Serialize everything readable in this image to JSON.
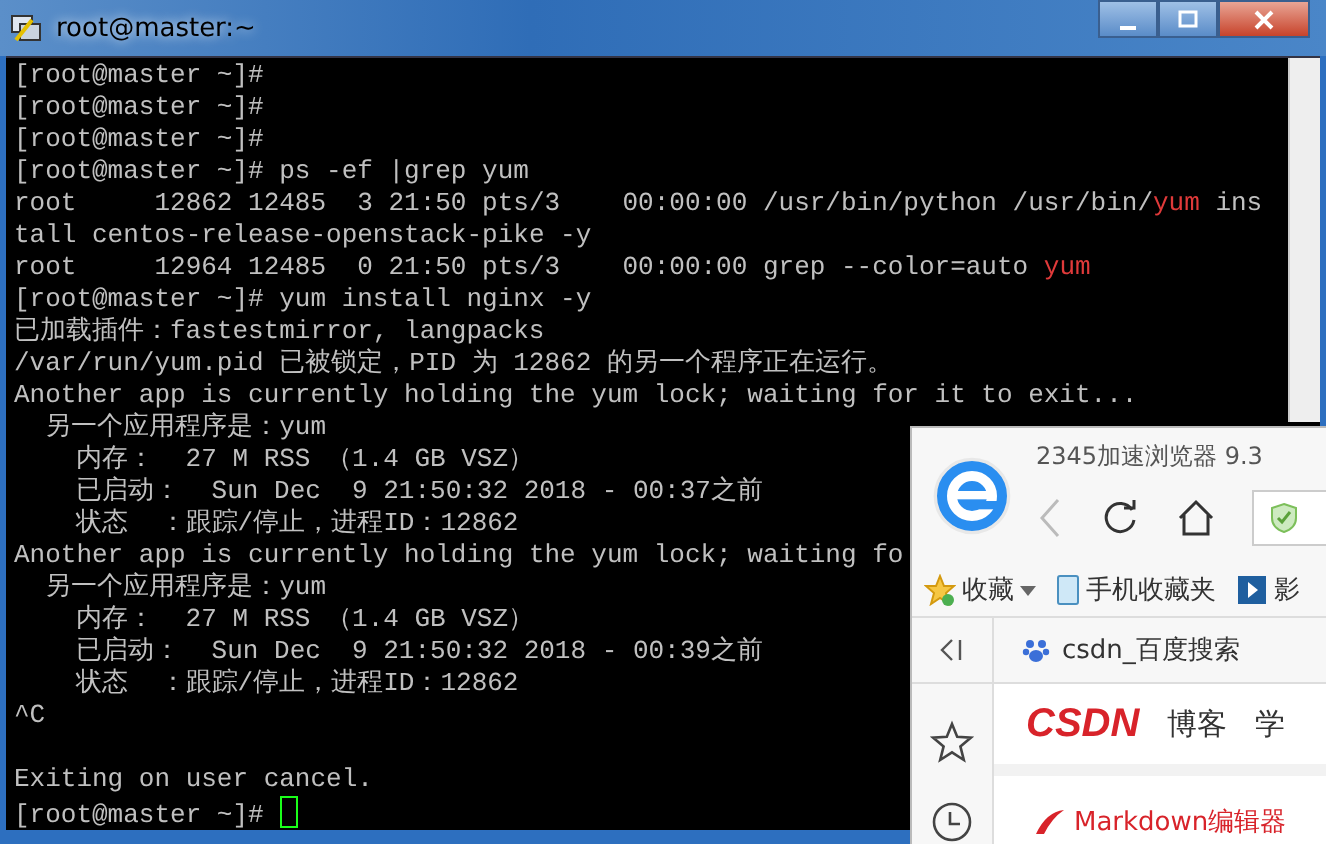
{
  "window": {
    "title": "root@master:~"
  },
  "terminal": {
    "lines": [
      {
        "segments": [
          {
            "text": "[root@master ~]#",
            "highlight": false
          }
        ]
      },
      {
        "segments": [
          {
            "text": "[root@master ~]#",
            "highlight": false
          }
        ]
      },
      {
        "segments": [
          {
            "text": "[root@master ~]#",
            "highlight": false
          }
        ]
      },
      {
        "segments": [
          {
            "text": "[root@master ~]# ps -ef |grep yum",
            "highlight": false
          }
        ]
      },
      {
        "segments": [
          {
            "text": "root     12862 12485  3 21:50 pts/3    00:00:00 /usr/bin/python /usr/bin/",
            "highlight": false
          },
          {
            "text": "yum",
            "highlight": true
          },
          {
            "text": " ins",
            "highlight": false
          }
        ]
      },
      {
        "segments": [
          {
            "text": "tall centos-release-openstack-pike -y",
            "highlight": false
          }
        ]
      },
      {
        "segments": [
          {
            "text": "root     12964 12485  0 21:50 pts/3    00:00:00 grep --color=auto ",
            "highlight": false
          },
          {
            "text": "yum",
            "highlight": true
          }
        ]
      },
      {
        "segments": [
          {
            "text": "[root@master ~]# yum install nginx -y",
            "highlight": false
          }
        ]
      },
      {
        "segments": [
          {
            "text": "已加载插件：fastestmirror, langpacks",
            "highlight": false
          }
        ]
      },
      {
        "segments": [
          {
            "text": "/var/run/yum.pid 已被锁定，PID 为 12862 的另一个程序正在运行。",
            "highlight": false
          }
        ]
      },
      {
        "segments": [
          {
            "text": "Another app is currently holding the yum lock; waiting for it to exit...",
            "highlight": false
          }
        ]
      },
      {
        "segments": [
          {
            "text": "  另一个应用程序是：yum",
            "highlight": false
          }
        ]
      },
      {
        "segments": [
          {
            "text": "    内存：  27 M RSS （1.4 GB VSZ）",
            "highlight": false
          }
        ]
      },
      {
        "segments": [
          {
            "text": "    已启动：  Sun Dec  9 21:50:32 2018 - 00:37之前",
            "highlight": false
          }
        ]
      },
      {
        "segments": [
          {
            "text": "    状态  ：跟踪/停止，进程ID：12862",
            "highlight": false
          }
        ]
      },
      {
        "segments": [
          {
            "text": "Another app is currently holding the yum lock; waiting fo",
            "highlight": false
          }
        ]
      },
      {
        "segments": [
          {
            "text": "  另一个应用程序是：yum",
            "highlight": false
          }
        ]
      },
      {
        "segments": [
          {
            "text": "    内存：  27 M RSS （1.4 GB VSZ）",
            "highlight": false
          }
        ]
      },
      {
        "segments": [
          {
            "text": "    已启动：  Sun Dec  9 21:50:32 2018 - 00:39之前",
            "highlight": false
          }
        ]
      },
      {
        "segments": [
          {
            "text": "    状态  ：跟踪/停止，进程ID：12862",
            "highlight": false
          }
        ]
      },
      {
        "segments": [
          {
            "text": "^C",
            "highlight": false
          }
        ]
      },
      {
        "blank_before": true,
        "segments": [
          {
            "text": "Exiting on user cancel.",
            "highlight": false
          }
        ]
      },
      {
        "cursor": true,
        "segments": [
          {
            "text": "[root@master ~]# ",
            "highlight": false
          }
        ]
      }
    ]
  },
  "browser": {
    "title": "2345加速浏览器 9.3",
    "bookmarks": [
      {
        "label": "收藏",
        "kind": "star"
      },
      {
        "label": "手机收藏夹",
        "kind": "phone"
      },
      {
        "label": "影",
        "kind": "film"
      }
    ],
    "tab": {
      "label": "csdn_百度搜索"
    },
    "page": {
      "logo": "CSDN",
      "nav": [
        "博客",
        "学"
      ],
      "item": "Markdown编辑器"
    }
  }
}
